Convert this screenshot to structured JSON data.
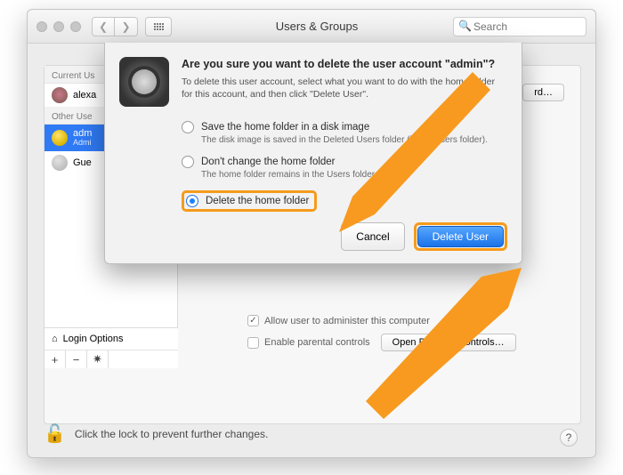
{
  "window": {
    "title": "Users & Groups",
    "search_placeholder": "Search"
  },
  "sidebar": {
    "section_current": "Current Us",
    "section_other": "Other Use",
    "items": [
      {
        "name": "alexa",
        "sub": ""
      },
      {
        "name": "adm",
        "sub": "Admi"
      },
      {
        "name": "Gue",
        "sub": ""
      }
    ],
    "login_options": "Login Options"
  },
  "main": {
    "change_password": "rd…",
    "checkbox_admin": "Allow user to administer this computer",
    "checkbox_parental": "Enable parental controls",
    "open_parental_btn": "Open Parental Controls…"
  },
  "footer": {
    "lock_text": "Click the lock to prevent further changes.",
    "help": "?"
  },
  "dialog": {
    "title": "Are you sure you want to delete the user account \"admin\"?",
    "desc": "To delete this user account, select what you want to do with the home folder for this account, and then click \"Delete User\".",
    "options": [
      {
        "label": "Save the home folder in a disk image",
        "sub": "The disk image is saved in the Deleted Users folder (in the Users folder).",
        "selected": false
      },
      {
        "label": "Don't change the home folder",
        "sub": "The home folder remains in the Users folder.",
        "selected": false
      },
      {
        "label": "Delete the home folder",
        "sub": "",
        "selected": true
      }
    ],
    "cancel": "Cancel",
    "confirm": "Delete User"
  }
}
